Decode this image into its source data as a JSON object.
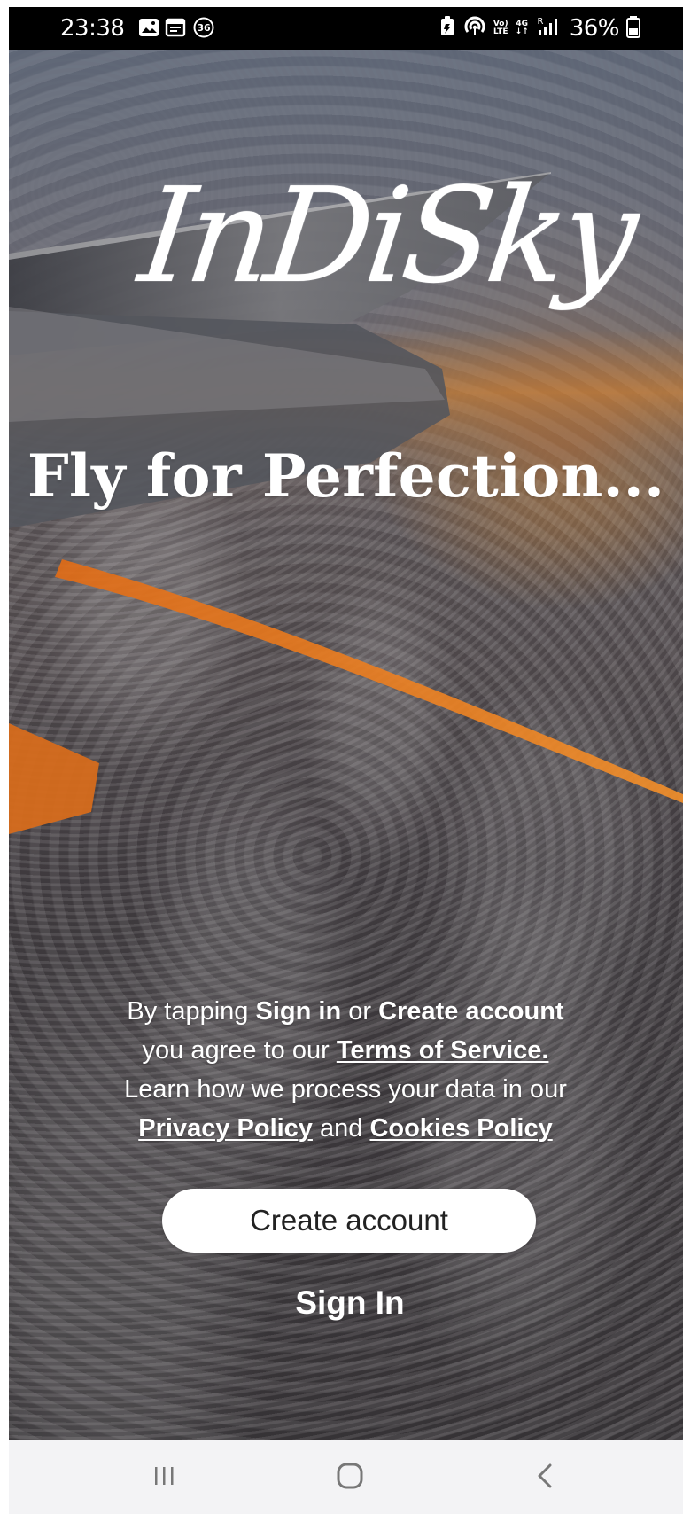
{
  "status_bar": {
    "time": "23:38",
    "left_badge": "36",
    "battery_percent": "36%",
    "network_top": "Vo)",
    "network_bottom": "LTE",
    "network_type": "4G",
    "roaming": "R",
    "icons": [
      "image-icon",
      "calendar-icon",
      "notification-count-icon",
      "battery-saver-icon",
      "hotspot-icon",
      "volte-icon",
      "signal-icon",
      "battery-icon"
    ]
  },
  "hero": {
    "logo_text": "InDiSky",
    "tagline": "Fly for Perfection..."
  },
  "legal": {
    "line1_prefix": "By tapping ",
    "sign_in_term": "Sign in",
    "line1_middle": " or ",
    "create_account_term": "Create account",
    "line2_prefix": "you agree to our ",
    "terms_link": "Terms of Service.",
    "line3": "Learn how we process your data in our",
    "privacy_link": "Privacy Policy",
    "line4_middle": " and ",
    "cookies_link": "Cookies Policy"
  },
  "actions": {
    "create_account_label": "Create account",
    "sign_in_label": "Sign In"
  },
  "nav": {
    "icons": [
      "recent-apps-icon",
      "home-icon",
      "back-icon"
    ]
  },
  "colors": {
    "primary_text": "#ffffff",
    "button_background": "#ffffff",
    "button_text": "#222222",
    "accent_orange": "#f08b25"
  }
}
